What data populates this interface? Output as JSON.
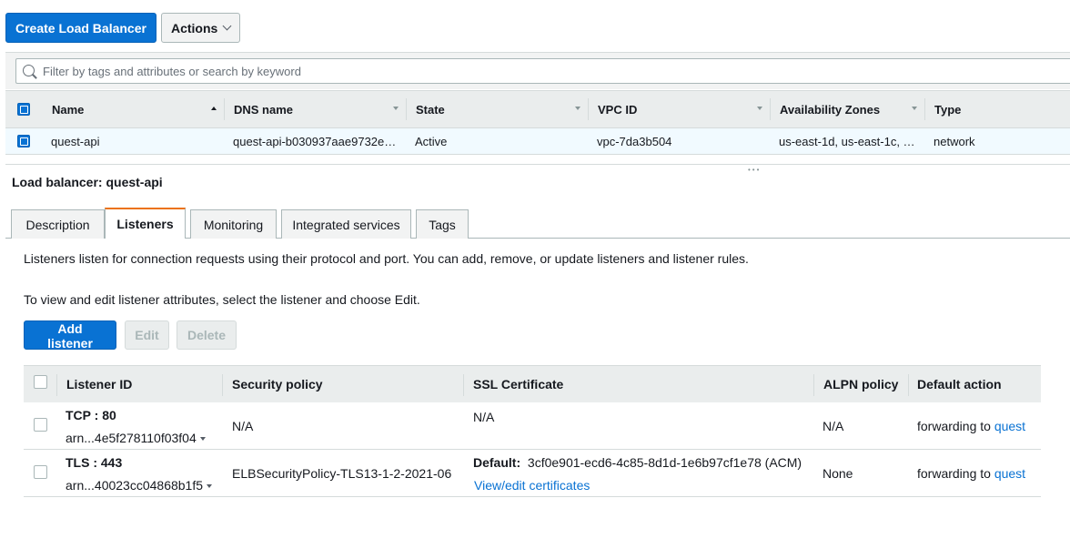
{
  "toolbar": {
    "create_label": "Create Load Balancer",
    "actions_label": "Actions"
  },
  "search": {
    "placeholder": "Filter by tags and attributes or search by keyword"
  },
  "lb_table": {
    "columns": [
      "Name",
      "DNS name",
      "State",
      "VPC ID",
      "Availability Zones",
      "Type"
    ],
    "rows": [
      {
        "name": "quest-api",
        "dns": "quest-api-b030937aae9732e…",
        "state": "Active",
        "vpc": "vpc-7da3b504",
        "azs": "us-east-1d, us-east-1c, …",
        "type": "network"
      }
    ]
  },
  "detail": {
    "title": "Load balancer: quest-api",
    "tabs": [
      "Description",
      "Listeners",
      "Monitoring",
      "Integrated services",
      "Tags"
    ],
    "active_tab": "Listeners",
    "desc1": "Listeners listen for connection requests using their protocol and port. You can add, remove, or update listeners and listener rules.",
    "desc2": "To view and edit listener attributes, select the listener and choose Edit.",
    "buttons": {
      "add": "Add listener",
      "edit": "Edit",
      "delete": "Delete"
    }
  },
  "listeners": {
    "columns": [
      "Listener ID",
      "Security policy",
      "SSL Certificate",
      "ALPN policy",
      "Default action"
    ],
    "rows": [
      {
        "protocol": "TCP : 80",
        "arn": "arn...4e5f278110f03f04",
        "policy": "N/A",
        "ssl": "N/A",
        "ssl_default_label": "",
        "ssl_link": "",
        "alpn": "N/A",
        "action_text": "forwarding to",
        "action_link": "quest"
      },
      {
        "protocol": "TLS : 443",
        "arn": "arn...40023cc04868b1f5",
        "policy": "ELBSecurityPolicy-TLS13-1-2-2021-06",
        "ssl_default_label": "Default:",
        "ssl": "3cf0e901-ecd6-4c85-8d1d-1e6b97cf1e78 (ACM)",
        "ssl_link": "View/edit certificates",
        "alpn": "None",
        "action_text": "forwarding to",
        "action_link": "quest"
      }
    ]
  },
  "colors": {
    "primary": "#0972d3",
    "tab_accent": "#ec7211",
    "selected_row": "#f1faff"
  }
}
